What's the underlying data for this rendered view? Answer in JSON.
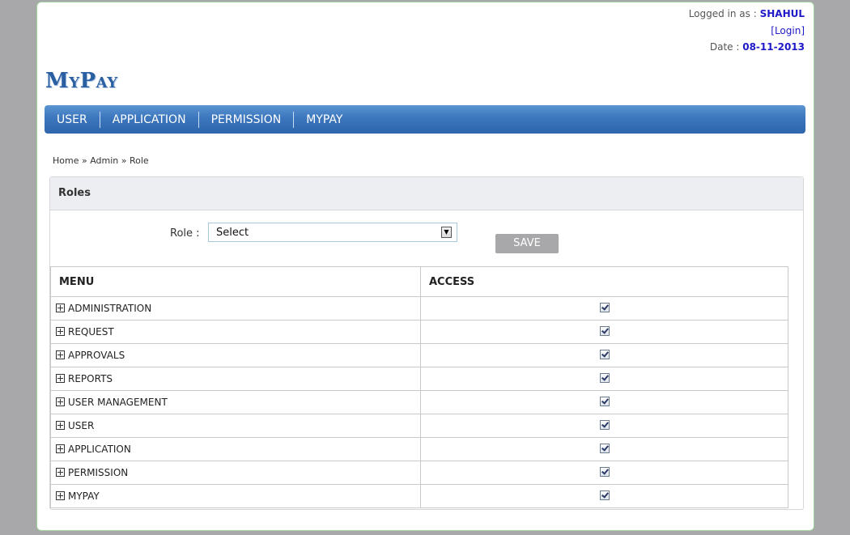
{
  "header": {
    "logged_in_prefix": "Logged in as : ",
    "username": "SHAHUL",
    "login_link": "Login",
    "date_prefix": "Date : ",
    "date": "08-11-2013"
  },
  "brand": {
    "title": "MyPay"
  },
  "nav": {
    "items": [
      {
        "label": "USER"
      },
      {
        "label": "APPLICATION"
      },
      {
        "label": "PERMISSION"
      },
      {
        "label": "MYPAY"
      }
    ]
  },
  "breadcrumb": {
    "text": "Home » Admin » Role"
  },
  "panel": {
    "title": "Roles",
    "role_label": "Role :",
    "role_select_value": "Select",
    "save_label": "SAVE"
  },
  "table": {
    "headers": {
      "menu": "MENU",
      "access": "ACCESS"
    },
    "rows": [
      {
        "menu": "ADMINISTRATION",
        "access": true
      },
      {
        "menu": "REQUEST",
        "access": true
      },
      {
        "menu": "APPROVALS",
        "access": true
      },
      {
        "menu": "REPORTS",
        "access": true
      },
      {
        "menu": "USER MANAGEMENT",
        "access": true
      },
      {
        "menu": "USER",
        "access": true
      },
      {
        "menu": "APPLICATION",
        "access": true
      },
      {
        "menu": "PERMISSION",
        "access": true
      },
      {
        "menu": "MYPAY",
        "access": true
      }
    ]
  }
}
